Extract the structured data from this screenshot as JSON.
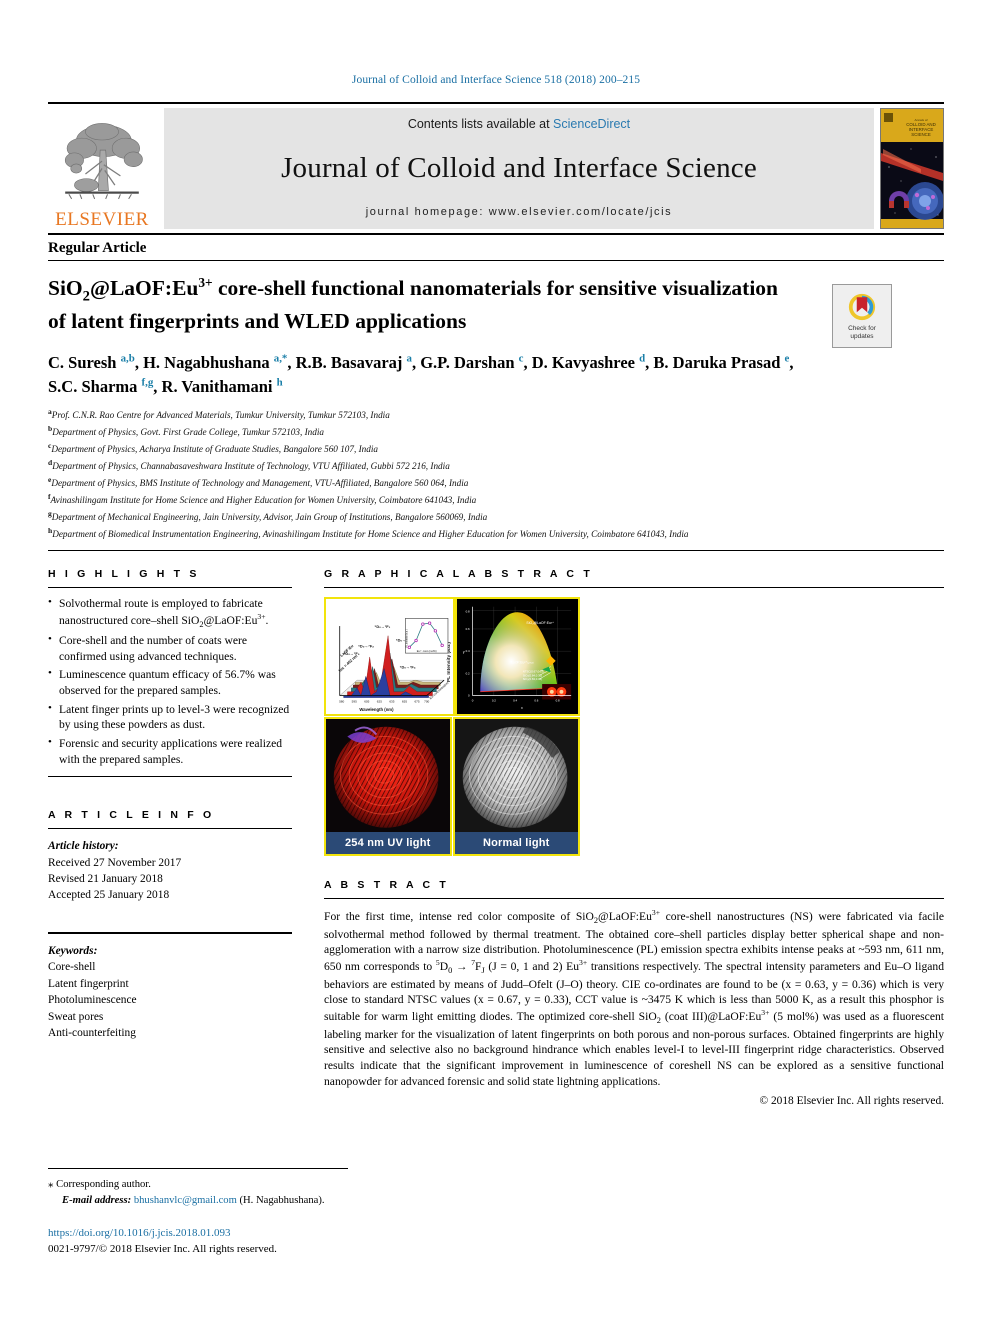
{
  "running_head": "Journal of Colloid and Interface Science 518 (2018) 200–215",
  "masthead": {
    "contents_prefix": "Contents lists available at ",
    "sciencedirect": "ScienceDirect",
    "journal_title": "Journal of Colloid and Interface Science",
    "homepage": "journal homepage: www.elsevier.com/locate/jcis",
    "publisher": "ELSEVIER",
    "cover_line1": "Annals of",
    "cover_line2": "COLLOID AND",
    "cover_line3": "INTERFACE",
    "cover_line4": "SCIENCE"
  },
  "article": {
    "type": "Regular Article",
    "title_line1_a": "SiO",
    "title_line1_sub": "2",
    "title_line1_b": "@LaOF:Eu",
    "title_line1_sup": "3+",
    "title_line1_c": " core-shell functional nanomaterials for sensitive",
    "title_line2": "visualization of latent fingerprints and WLED applications",
    "crossmark_label": "Check for\nupdates"
  },
  "authors": [
    {
      "name": "C. Suresh ",
      "sup": "a,b"
    },
    {
      "name": ", H. Nagabhushana ",
      "sup": "a,*"
    },
    {
      "name": ", R.B. Basavaraj ",
      "sup": "a"
    },
    {
      "name": ", G.P. Darshan ",
      "sup": "c"
    },
    {
      "name": ", D. Kavyashree ",
      "sup": "d"
    },
    {
      "name": ", B. Daruka Prasad ",
      "sup": "e"
    },
    {
      "name": ",",
      "sup": ""
    },
    {
      "name": "S.C. Sharma ",
      "sup": "f,g"
    },
    {
      "name": ", R. Vanithamani ",
      "sup": "h"
    }
  ],
  "affiliations": [
    {
      "mark": "a",
      "text": "Prof. C.N.R. Rao Centre for Advanced Materials, Tumkur University, Tumkur 572103, India"
    },
    {
      "mark": "b",
      "text": "Department of Physics, Govt. First Grade College, Tumkur 572103, India"
    },
    {
      "mark": "c",
      "text": "Department of Physics, Acharya Institute of Graduate Studies, Bangalore 560 107, India"
    },
    {
      "mark": "d",
      "text": "Department of Physics, Channabasaveshwara Institute of Technology, VTU Affiliated, Gubbi 572 216, India"
    },
    {
      "mark": "e",
      "text": "Department of Physics, BMS Institute of Technology and Management, VTU-Affiliated, Bangalore 560 064, India"
    },
    {
      "mark": "f",
      "text": "Avinashilingam Institute for Home Science and Higher Education for Women University, Coimbatore 641043, India"
    },
    {
      "mark": "g",
      "text": "Department of Mechanical Engineering, Jain University, Advisor, Jain Group of Institutions, Bangalore 560069, India"
    },
    {
      "mark": "h",
      "text": "Department of Biomedical Instrumentation Engineering, Avinashilingam Institute for Home Science and Higher Education for Women University, Coimbatore 641043, India"
    }
  ],
  "highlights": {
    "heading": "H I G H L I G H T S",
    "items": [
      {
        "a": "Solvothermal route is employed to fabricate nanostructured core–shell SiO",
        "sub": "2",
        "b": "@LaOF:Eu",
        "sup": "3+",
        "c": "."
      },
      {
        "a": "Core-shell and the number of coats were confirmed using advanced techniques.",
        "sub": "",
        "b": "",
        "sup": "",
        "c": ""
      },
      {
        "a": "Luminescence quantum efficacy of 56.7% was observed for the prepared samples.",
        "sub": "",
        "b": "",
        "sup": "",
        "c": ""
      },
      {
        "a": "Latent finger prints up to level-3 were recognized by using these powders as dust.",
        "sub": "",
        "b": "",
        "sup": "",
        "c": ""
      },
      {
        "a": "Forensic and security applications were realized with the prepared samples.",
        "sub": "",
        "b": "",
        "sup": "",
        "c": ""
      }
    ]
  },
  "article_info": {
    "heading": "A R T I C L E    I N F O",
    "history_label": "Article history:",
    "received": "Received 27 November 2017",
    "revised": "Revised 21 January 2018",
    "accepted": "Accepted 25 January 2018",
    "keywords_label": "Keywords:",
    "keywords": [
      "Core-shell",
      "Latent fingerprint",
      "Photoluminescence",
      "Sweat pores",
      "Anti-counterfeiting"
    ]
  },
  "graphical_abstract": {
    "heading": "G R A P H I C A L   A B S T R A C T",
    "pl_plot": {
      "ylabel": "PL Intensity (a.u.)",
      "xlabel": "Wavelength (nm)",
      "zlabel": "Eu concentration",
      "series_label": "LaOF:Eu",
      "excitation": "λex = 462 nm",
      "peak_labels": [
        "5D0 → 7F0",
        "5D0 → 7F1",
        "5D0 → 7F2",
        "5D0 → 7F3",
        "5D0 → 7F4"
      ],
      "inset_xlabel": "Eu3+ conc.(mol%)",
      "inset_ylabel": "PL Intensity (a.u.)",
      "xticks": [
        "580",
        "595",
        "605",
        "625",
        "635",
        "655",
        "675",
        "700"
      ],
      "zticks": [
        "1",
        "3",
        "5",
        "7",
        "9",
        "11"
      ]
    },
    "cie_plot": {
      "sample_label": "SiO2@LaOF:Eu3+",
      "point_label": "LaOF:Eu3+",
      "ref_lines": [
        "NTSC (0.67,0.33)",
        "SiO2 (0.64,0.35)",
        "SiO2 (0.63,0.36)"
      ],
      "xticks": [
        "0",
        "0.2",
        "0.4",
        "0.6",
        "0.8"
      ],
      "yticks": [
        "0",
        "0.2",
        "0.4",
        "0.6",
        "0.8"
      ],
      "xlabel": "x",
      "ylabel": "y"
    },
    "fingerprints": [
      {
        "caption": "254 nm UV light"
      },
      {
        "caption": "Normal light"
      }
    ]
  },
  "abstract": {
    "heading": "A B S T R A C T",
    "p1_a": "For the first time, intense red color composite of SiO",
    "p1_sub1": "2",
    "p1_b": "@LaOF:Eu",
    "p1_sup1": "3+",
    "p1_c": " core-shell nanostructures (NS) were fabricated via facile solvothermal method followed by thermal treatment. The obtained core–shell particles display better spherical shape and non-agglomeration with a narrow size distribution. Photoluminescence (PL) emission spectra exhibits intense peaks at ~593 nm, 611 nm, 650 nm corresponds to ",
    "p1_sup2": "5",
    "p1_d": "D",
    "p1_sub2": "0",
    "p1_e": " → ",
    "p1_sup3": "7",
    "p1_f": "F",
    "p1_sub3": "J",
    "p1_g": " (J = 0, 1 and 2) Eu",
    "p1_sup4": "3+",
    "p1_h": " transitions respectively. The spectral intensity parameters and Eu–O ligand behaviors are estimated by means of Judd–Ofelt (J–O) theory. CIE co-ordinates are found to be (x = 0.63, y = 0.36) which is very close to standard NTSC values (x = 0.67, y = 0.33), CCT value is ~3475 K which is less than 5000 K, as a result this phosphor is suitable for warm light emitting diodes. The optimized core-shell SiO",
    "p1_sub4": "2",
    "p1_i": " (coat III)@LaOF:Eu",
    "p1_sup5": "3+",
    "p1_j": " (5 mol%) was used as a fluorescent labeling marker for the visualization of latent fingerprints on both porous and non-porous surfaces. Obtained fingerprints are highly sensitive and selective also no background hindrance which enables level-I to level-III fingerprint ridge characteristics. Observed results indicate that the significant improvement in luminescence of coreshell NS can be explored as a sensitive functional nanopowder for advanced forensic and solid state lightning applications.",
    "copyright": "© 2018 Elsevier Inc. All rights reserved."
  },
  "footer": {
    "corresponding": "Corresponding author.",
    "email_label": "E-mail address:",
    "email": "bhushanvlc@gmail.com",
    "email_owner": "(H. Nagabhushana).",
    "doi": "https://doi.org/10.1016/j.jcis.2018.01.093",
    "issn": "0021-9797/© 2018 Elsevier Inc. All rights reserved."
  },
  "colors": {
    "link": "#1a6fa3",
    "elsevier_orange": "#E87722",
    "affil_sup": "#1b7fa8",
    "caption_bar": "#2b4a76",
    "figure_border": "#f2e40c"
  }
}
